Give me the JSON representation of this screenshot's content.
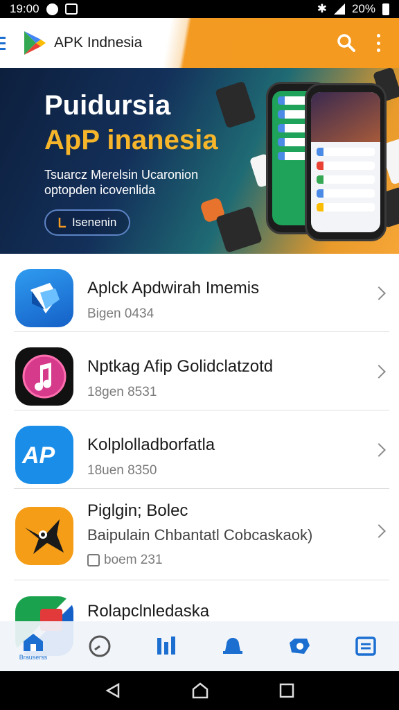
{
  "status_bar": {
    "time": "19:00",
    "battery": "20%"
  },
  "app_bar": {
    "title": "APK Indnesia"
  },
  "banner": {
    "title_line1": "Puidursia",
    "title_line2": "ApP inanesia",
    "subtitle_line1": "Tsuarcz Merelsin Ucaronion",
    "subtitle_line2": "optopden icovenlida",
    "button_label": "Isenenin"
  },
  "apps": [
    {
      "name": "Aplck Apdwirah Imemis",
      "meta": "Bigen 0434"
    },
    {
      "name": "Nptkag Afip Golidclatzotd",
      "meta": "18gen 8531"
    },
    {
      "name": "Kolplolladborfatla",
      "meta": "18uen 8350"
    },
    {
      "name": "Piglgin; Bolec",
      "description": "Baipulain Chbantatl Cobcaskaok)",
      "meta": "boem 231"
    },
    {
      "name": "Rolapclnledaska"
    }
  ],
  "bottom_nav": {
    "home_label": "Brauserss"
  },
  "colors": {
    "accent": "#1c6fd1",
    "brand_orange": "#f39a22"
  }
}
